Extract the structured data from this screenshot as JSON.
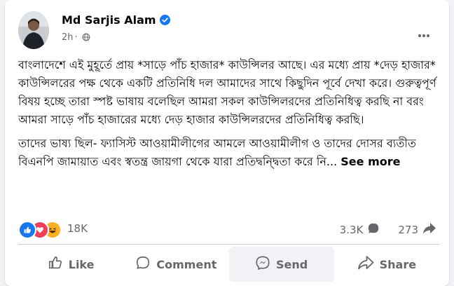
{
  "post": {
    "author": "Md Sarjis Alam",
    "time": "2h",
    "separator": "·",
    "paragraph1": "বাংলাদেশে এই মুহূর্তে প্রায় *সাড়ে পাঁচ হাজার* কাউন্সিলর আছে। এর মধ্যে প্রায় *দেড় হাজার* কাউন্সিলরের পক্ষ থেকে একটি প্রতিনিধি দল আমাদের সাথে কিছুদিন পূর্বে দেখা করে। গুরুত্বপূর্ণ বিষয় হচ্ছে তারা স্পষ্ট ভাষায় বলেছিল আমরা সকল কাউন্সিলরদের প্রতিনিধিত্ব করছি না বরং আমরা সাড়ে পাঁচ হাজারের মধ্যে দেড় হাজার কাউন্সিলরদের প্রতিনিধিত্ব করছি।",
    "paragraph2": "তাদের ভাষ্য ছিল- ফ্যাসিস্ট আওয়ামীলীগের আমলে আওয়ামীলীগ ও তাদের দোসর ব্যতীত বিএনপি জামায়াত এবং স্বতন্ত্র জায়গা থেকে যারা প্রতিদ্বন্দ্বিতা করে নি...",
    "see_more": "See more"
  },
  "reactions": {
    "count": "18K",
    "comments": "3.3K",
    "shares": "273",
    "types": [
      "like-icon",
      "love-icon",
      "haha-icon"
    ]
  },
  "actions": {
    "like": "Like",
    "comment": "Comment",
    "send": "Send",
    "share": "Share"
  },
  "colors": {
    "accent": "#1877f2",
    "love": "#f33e58",
    "haha": "#f7b125",
    "muted": "#65676b"
  }
}
